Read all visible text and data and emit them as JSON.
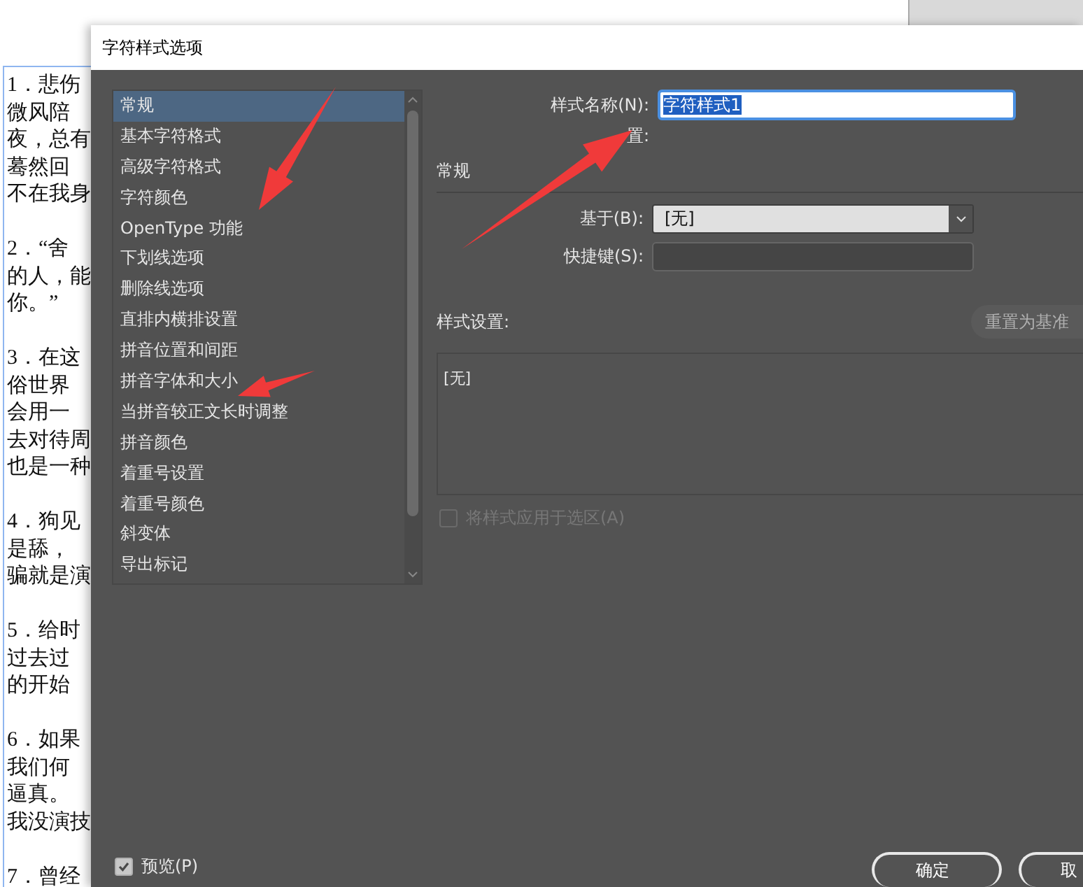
{
  "document": {
    "paragraphs": [
      {
        "lines": [
          "1．悲伤",
          "微风陪",
          "夜，总有",
          "蓦然回",
          "不在我身"
        ]
      },
      {
        "lines": [
          "2．“舍",
          "的人，能",
          "你。”"
        ]
      },
      {
        "lines": [
          "3．在这",
          "俗世界",
          "会用一",
          "去对待周",
          "也是一种"
        ]
      },
      {
        "lines": [
          "4．狗见",
          "是舔，",
          "骗就是演"
        ]
      },
      {
        "lines": [
          "5．给时",
          "过去过",
          "的开始"
        ]
      },
      {
        "lines": [
          "6．如果",
          "我们何",
          "逼真。",
          "我没演技"
        ]
      },
      {
        "lines": [
          "7．曾经"
        ]
      }
    ]
  },
  "dialog": {
    "title": "字符样式选项",
    "categories": [
      {
        "label": "常规",
        "selected": true
      },
      {
        "label": "基本字符格式",
        "selected": false
      },
      {
        "label": "高级字符格式",
        "selected": false
      },
      {
        "label": "字符颜色",
        "selected": false
      },
      {
        "label": "OpenType 功能",
        "selected": false
      },
      {
        "label": "下划线选项",
        "selected": false
      },
      {
        "label": "删除线选项",
        "selected": false
      },
      {
        "label": "直排内横排设置",
        "selected": false
      },
      {
        "label": "拼音位置和间距",
        "selected": false
      },
      {
        "label": "拼音字体和大小",
        "selected": false
      },
      {
        "label": "当拼音较正文长时调整",
        "selected": false
      },
      {
        "label": "拼音颜色",
        "selected": false
      },
      {
        "label": "着重号设置",
        "selected": false
      },
      {
        "label": "着重号颜色",
        "selected": false
      },
      {
        "label": "斜变体",
        "selected": false
      },
      {
        "label": "导出标记",
        "selected": false
      }
    ],
    "style_name": {
      "label": "样式名称(N):",
      "value": "字符样式1"
    },
    "partial_label": "置:",
    "section": "常规",
    "based_on": {
      "label": "基于(B):",
      "value": "[无]"
    },
    "shortcut": {
      "label": "快捷键(S):"
    },
    "style_settings": {
      "label": "样式设置:",
      "reset_button": "重置为基准",
      "summary": "[无]"
    },
    "apply_to_selection": {
      "label": "将样式应用于选区(A)",
      "checked": false,
      "disabled": true
    },
    "preview": {
      "label": "预览(P)",
      "checked": true
    },
    "buttons": [
      "确定",
      "取"
    ]
  }
}
